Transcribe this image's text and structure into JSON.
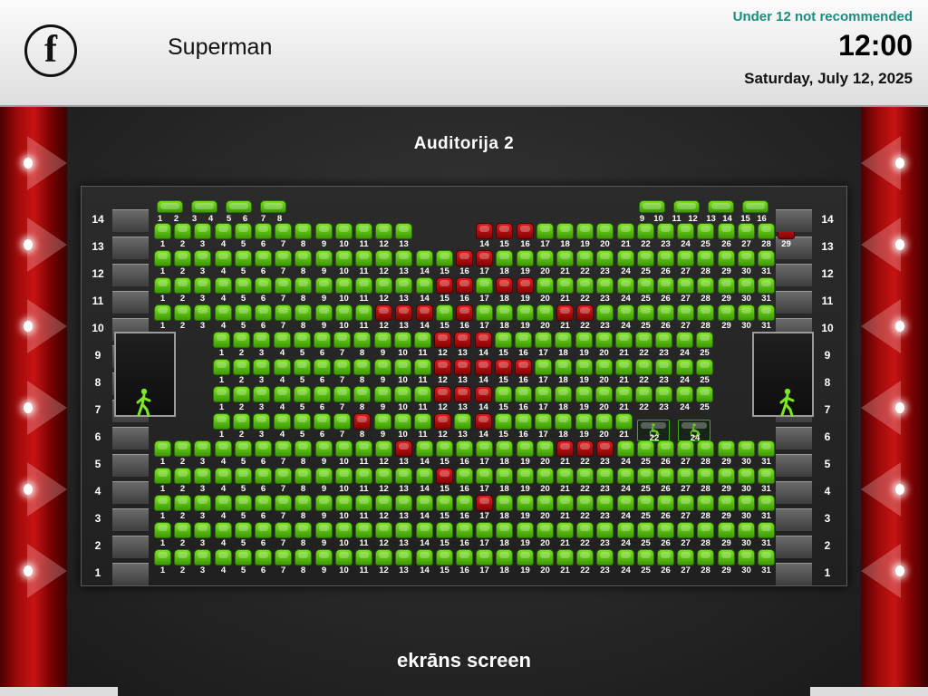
{
  "header": {
    "logo_letter": "f",
    "movie_title": "Superman",
    "age_rating": "Under 12 not recommended",
    "time": "12:00",
    "date": "Saturday, July 12, 2025"
  },
  "auditorium": {
    "name": "Auditorija 2",
    "screen_label": "ekrāns screen"
  },
  "icons": {
    "exit": "exit-person-icon",
    "wheelchair": "wheelchair-icon"
  },
  "colors": {
    "seat_free": "#5cc410",
    "seat_taken": "#c40f0f",
    "age_rating": "#1c8c80",
    "curtain": "#c81313"
  },
  "rows": [
    {
      "row": "1",
      "seats": [
        "1",
        "2",
        "3",
        "4",
        "5",
        "6",
        "7",
        "8",
        "9",
        "10",
        "11",
        "12",
        "13",
        "14",
        "15",
        "16",
        "17",
        "18",
        "19",
        "20",
        "21",
        "22",
        "23",
        "24",
        "25",
        "26",
        "27",
        "28",
        "29",
        "30",
        "31"
      ],
      "taken": []
    },
    {
      "row": "2",
      "seats": [
        "1",
        "2",
        "3",
        "4",
        "5",
        "6",
        "7",
        "8",
        "9",
        "10",
        "11",
        "12",
        "13",
        "14",
        "15",
        "16",
        "17",
        "18",
        "19",
        "20",
        "21",
        "22",
        "23",
        "24",
        "25",
        "26",
        "27",
        "28",
        "29",
        "30",
        "31"
      ],
      "taken": []
    },
    {
      "row": "3",
      "seats": [
        "1",
        "2",
        "3",
        "4",
        "5",
        "6",
        "7",
        "8",
        "9",
        "10",
        "11",
        "12",
        "13",
        "14",
        "15",
        "16",
        "17",
        "18",
        "19",
        "20",
        "21",
        "22",
        "23",
        "24",
        "25",
        "26",
        "27",
        "28",
        "29",
        "30",
        "31"
      ],
      "taken": [
        "17"
      ]
    },
    {
      "row": "4",
      "seats": [
        "1",
        "2",
        "3",
        "4",
        "5",
        "6",
        "7",
        "8",
        "9",
        "10",
        "11",
        "12",
        "13",
        "14",
        "15",
        "16",
        "17",
        "18",
        "19",
        "20",
        "21",
        "22",
        "23",
        "24",
        "25",
        "26",
        "27",
        "28",
        "29",
        "30",
        "31"
      ],
      "taken": [
        "15"
      ]
    },
    {
      "row": "5",
      "seats": [
        "1",
        "2",
        "3",
        "4",
        "5",
        "6",
        "7",
        "8",
        "9",
        "10",
        "11",
        "12",
        "13",
        "14",
        "15",
        "16",
        "17",
        "18",
        "19",
        "20",
        "21",
        "22",
        "23",
        "24",
        "25",
        "26",
        "27",
        "28",
        "29",
        "30",
        "31"
      ],
      "taken": [
        "13",
        "21",
        "22",
        "23"
      ]
    },
    {
      "row": "6",
      "seats": [
        "1",
        "2",
        "3",
        "4",
        "5",
        "6",
        "7",
        "8",
        "9",
        "10",
        "11",
        "12",
        "13",
        "14",
        "15",
        "16",
        "17",
        "18",
        "19",
        "20",
        "21"
      ],
      "taken": [
        "8",
        "12",
        "14"
      ],
      "wheelchair": [
        "22",
        "24"
      ]
    },
    {
      "row": "7",
      "seats": [
        "1",
        "2",
        "3",
        "4",
        "5",
        "6",
        "7",
        "8",
        "9",
        "10",
        "11",
        "12",
        "13",
        "14",
        "15",
        "16",
        "17",
        "18",
        "19",
        "20",
        "21",
        "22",
        "23",
        "24",
        "25"
      ],
      "taken": [
        "12",
        "13",
        "14"
      ]
    },
    {
      "row": "8",
      "seats": [
        "1",
        "2",
        "3",
        "4",
        "5",
        "6",
        "7",
        "8",
        "9",
        "10",
        "11",
        "12",
        "13",
        "14",
        "15",
        "16",
        "17",
        "18",
        "19",
        "20",
        "21",
        "22",
        "23",
        "24",
        "25"
      ],
      "taken": [
        "12",
        "13",
        "14",
        "15",
        "16"
      ]
    },
    {
      "row": "9",
      "seats": [
        "1",
        "2",
        "3",
        "4",
        "5",
        "6",
        "7",
        "8",
        "9",
        "10",
        "11",
        "12",
        "13",
        "14",
        "15",
        "16",
        "17",
        "18",
        "19",
        "20",
        "21",
        "22",
        "23",
        "24",
        "25"
      ],
      "taken": [
        "12",
        "13",
        "14"
      ]
    },
    {
      "row": "10",
      "seats": [
        "1",
        "2",
        "3",
        "4",
        "5",
        "6",
        "7",
        "8",
        "9",
        "10",
        "11",
        "12",
        "13",
        "14",
        "15",
        "16",
        "17",
        "18",
        "19",
        "20",
        "21",
        "22",
        "23",
        "24",
        "25",
        "26",
        "27",
        "28",
        "29",
        "30",
        "31"
      ],
      "taken": [
        "12",
        "13",
        "14",
        "16",
        "21",
        "22"
      ]
    },
    {
      "row": "11",
      "seats": [
        "1",
        "2",
        "3",
        "4",
        "5",
        "6",
        "7",
        "8",
        "9",
        "10",
        "11",
        "12",
        "13",
        "14",
        "15",
        "16",
        "17",
        "18",
        "19",
        "20",
        "21",
        "22",
        "23",
        "24",
        "25",
        "26",
        "27",
        "28",
        "29",
        "30",
        "31"
      ],
      "taken": [
        "15",
        "16",
        "18",
        "19"
      ]
    },
    {
      "row": "12",
      "seats": [
        "1",
        "2",
        "3",
        "4",
        "5",
        "6",
        "7",
        "8",
        "9",
        "10",
        "11",
        "12",
        "13",
        "14",
        "15",
        "16",
        "17",
        "18",
        "19",
        "20",
        "21",
        "22",
        "23",
        "24",
        "25",
        "26",
        "27",
        "28",
        "29",
        "30",
        "31"
      ],
      "taken": [
        "16",
        "17"
      ]
    },
    {
      "row": "13",
      "seats": [
        "1",
        "2",
        "3",
        "4",
        "5",
        "6",
        "7",
        "8",
        "9",
        "10",
        "11",
        "12",
        "13",
        "14",
        "15",
        "16",
        "17",
        "18",
        "19",
        "20",
        "21",
        "22",
        "23",
        "24",
        "25",
        "26",
        "27",
        "28",
        "29"
      ],
      "taken": [
        "14",
        "15",
        "16",
        "30"
      ]
    },
    {
      "row": "14",
      "sofas": [
        [
          "1",
          "2"
        ],
        [
          "3",
          "4"
        ],
        [
          "5",
          "6"
        ],
        [
          "7",
          "8"
        ],
        [
          "9",
          "10"
        ],
        [
          "11",
          "12"
        ],
        [
          "13",
          "14"
        ],
        [
          "15",
          "16"
        ]
      ],
      "taken": []
    }
  ]
}
